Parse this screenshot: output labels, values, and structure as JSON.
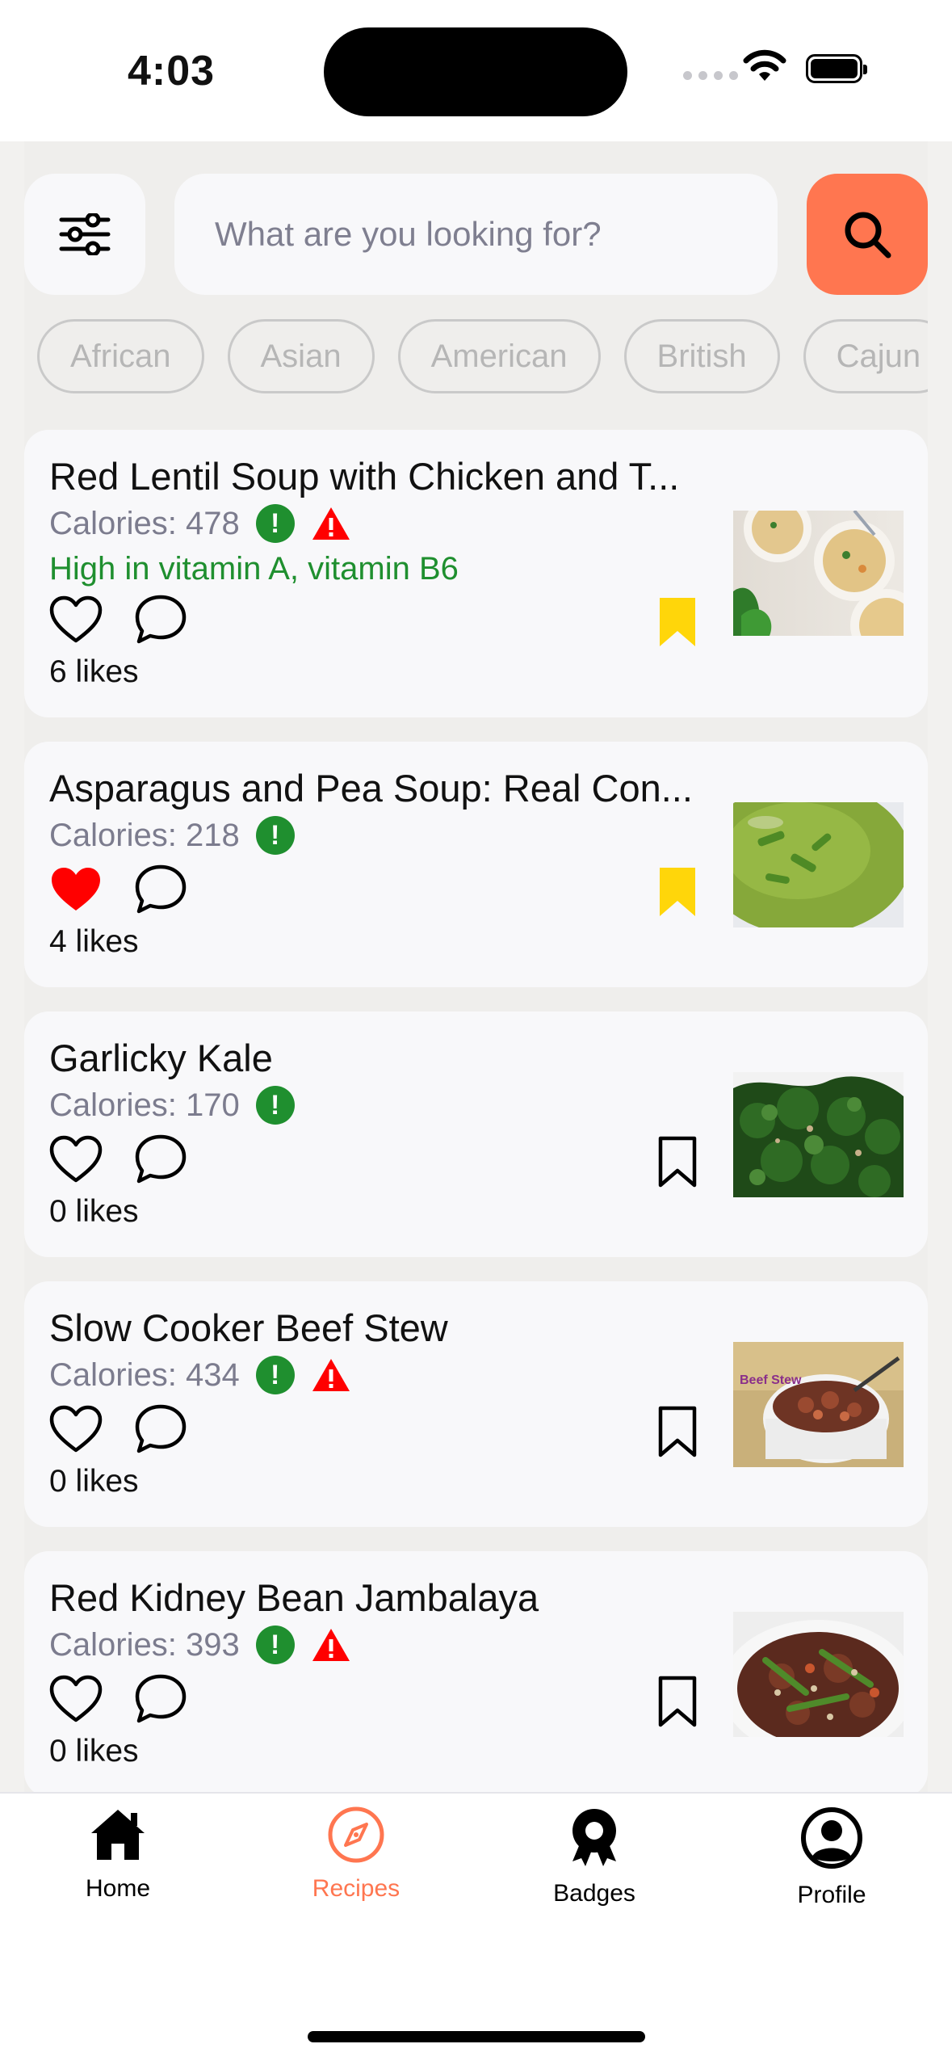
{
  "status_bar": {
    "time": "4:03"
  },
  "search": {
    "placeholder": "What are you looking for?"
  },
  "cuisines": [
    "African",
    "Asian",
    "American",
    "British",
    "Cajun"
  ],
  "recipes": [
    {
      "title": "Red Lentil Soup with Chicken and T...",
      "calories": "Calories: 478",
      "warning": true,
      "vitamins": "High in vitamin A, vitamin B6",
      "liked": false,
      "saved": true,
      "likes": "6 likes",
      "image": "lentil-soup"
    },
    {
      "title": "Asparagus and Pea Soup: Real Con...",
      "calories": "Calories: 218",
      "warning": false,
      "vitamins": "",
      "liked": true,
      "saved": true,
      "likes": "4 likes",
      "image": "pea-soup"
    },
    {
      "title": "Garlicky Kale",
      "calories": "Calories: 170",
      "warning": false,
      "vitamins": "",
      "liked": false,
      "saved": false,
      "likes": "0 likes",
      "image": "kale"
    },
    {
      "title": "Slow Cooker Beef Stew",
      "calories": "Calories: 434",
      "warning": true,
      "vitamins": "",
      "liked": false,
      "saved": false,
      "likes": "0 likes",
      "image": "beef-stew",
      "image_text": "Beef Stew"
    },
    {
      "title": "Red Kidney Bean Jambalaya",
      "calories": "Calories: 393",
      "warning": true,
      "vitamins": "",
      "liked": false,
      "saved": false,
      "likes": "0 likes",
      "image": "jambalaya"
    }
  ],
  "tabs": [
    {
      "label": "Home",
      "icon": "house-icon",
      "active": false
    },
    {
      "label": "Recipes",
      "icon": "compass-icon",
      "active": true
    },
    {
      "label": "Badges",
      "icon": "award-icon",
      "active": false
    },
    {
      "label": "Profile",
      "icon": "person-circle-icon",
      "active": false
    }
  ],
  "colors": {
    "accent": "#ff7650",
    "good": "#1f8f2f",
    "warn": "#ff0000",
    "bookmark": "#ffd60a",
    "liked": "#ff0000"
  }
}
